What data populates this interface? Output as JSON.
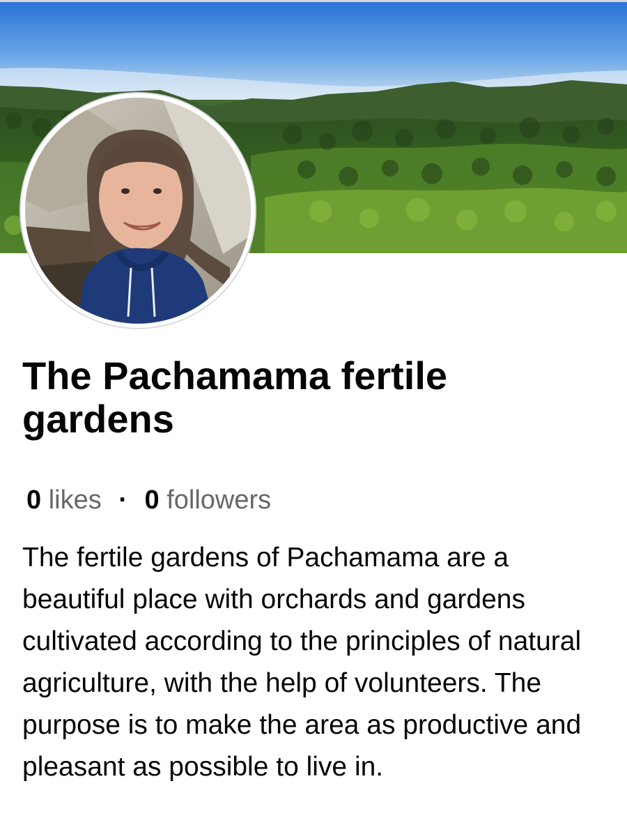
{
  "page": {
    "name": "The Pachamama fertile gardens",
    "stats": {
      "likes_count": "0",
      "likes_label": "likes",
      "separator": "·",
      "followers_count": "0",
      "followers_label": "followers"
    },
    "bio": "The fertile gardens of Pachamama are a beautiful place with orchards and gardens cultivated according to the principles of natural agriculture, with the help of volunteers. The purpose is to make the area as productive and pleasant as possible to live in."
  },
  "colors": {
    "text_primary": "#050505",
    "text_secondary": "#65676b",
    "background": "#ffffff",
    "avatar_border": "#dadde1"
  },
  "icons": {
    "cover": "cover-photo-landscape",
    "avatar": "profile-photo"
  }
}
